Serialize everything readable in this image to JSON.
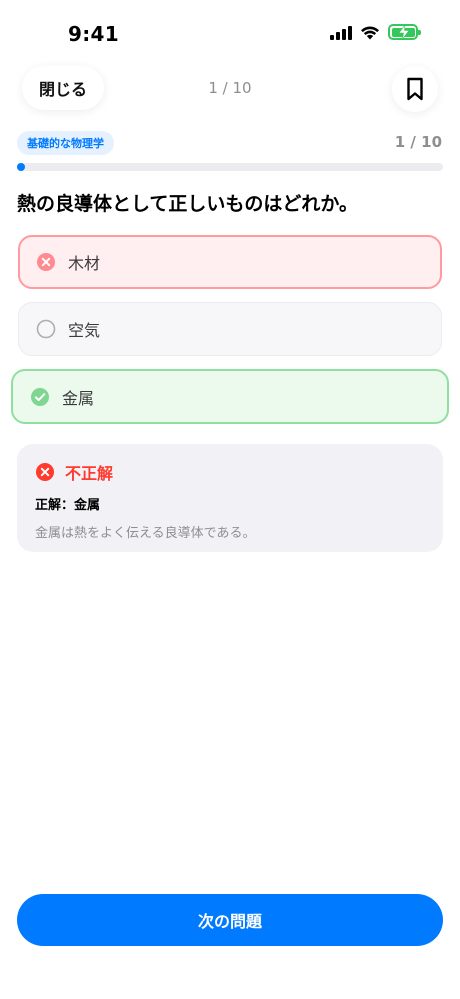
{
  "status_bar": {
    "time": "9:41"
  },
  "nav": {
    "close_label": "閉じる",
    "counter": "1 / 10"
  },
  "quiz": {
    "category": "基礎的な物理学",
    "progress_text": "1 / 10",
    "progress_fraction": 0.1,
    "question": "熱の良導体として正しいものはどれか。",
    "options": [
      {
        "label": "木材",
        "state": "wrong-selected"
      },
      {
        "label": "空気",
        "state": "neutral"
      },
      {
        "label": "金属",
        "state": "correct"
      }
    ]
  },
  "feedback": {
    "title": "不正解",
    "answer": "正解：金属",
    "explanation": "金属は熱をよく伝える良導体である。"
  },
  "next_button_label": "次の問題",
  "colors": {
    "accent": "#007aff",
    "error": "#ff3b30",
    "success": "#34c759"
  },
  "icons": {
    "bookmark": "bookmark-icon",
    "wrong": "x-circle-icon",
    "correct": "check-circle-icon",
    "unselected": "radio-empty-icon"
  }
}
